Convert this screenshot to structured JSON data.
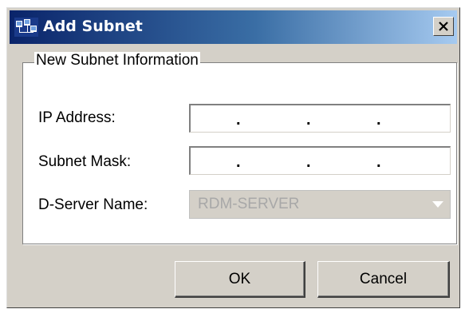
{
  "window": {
    "title": "Add Subnet"
  },
  "group": {
    "title": "New Subnet Information"
  },
  "fields": {
    "ip_address_label": "IP Address:",
    "subnet_mask_label": "Subnet Mask:",
    "server_name_label": "D-Server Name:",
    "server_name_value": "RDM-SERVER",
    "ip_separator": "."
  },
  "buttons": {
    "ok_label": "OK",
    "cancel_label": "Cancel"
  },
  "icons": {
    "app": "network-icon",
    "close": "close-icon",
    "dropdown": "chevron-down-icon"
  },
  "colors": {
    "title_bar_start": "#0a246a",
    "title_bar_end": "#a6caf0",
    "dialog_bg": "#d4d0c8",
    "disabled_text": "#a8a8a8"
  }
}
